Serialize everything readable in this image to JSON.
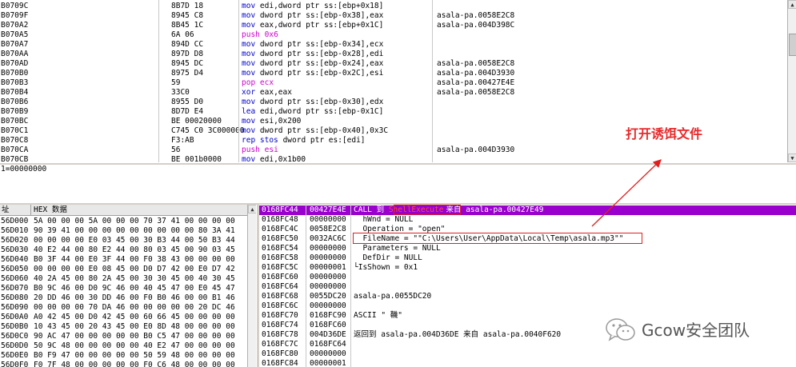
{
  "disasm": {
    "rows": [
      {
        "addr": "B0709C",
        "bytes": "8B7D 18",
        "mnemonic": "mov",
        "args": "edi,dword ptr ss:[ebp+0x18]",
        "comment": ""
      },
      {
        "addr": "B0709F",
        "bytes": "8945 C8",
        "mnemonic": "mov",
        "args": "dword ptr ss:[ebp-0x38],eax",
        "comment": "asala-pa.0058E2C8"
      },
      {
        "addr": "B070A2",
        "bytes": "8B45 1C",
        "mnemonic": "mov",
        "args": "eax,dword ptr ss:[ebp+0x1C]",
        "comment": "asala-pa.004D398C"
      },
      {
        "addr": "B070A5",
        "bytes": "6A 06",
        "mnemonic": "push",
        "args": "0x6",
        "comment": ""
      },
      {
        "addr": "B070A7",
        "bytes": "894D CC",
        "mnemonic": "mov",
        "args": "dword ptr ss:[ebp-0x34],ecx",
        "comment": ""
      },
      {
        "addr": "B070AA",
        "bytes": "897D D8",
        "mnemonic": "mov",
        "args": "dword ptr ss:[ebp-0x28],edi",
        "comment": ""
      },
      {
        "addr": "B070AD",
        "bytes": "8945 DC",
        "mnemonic": "mov",
        "args": "dword ptr ss:[ebp-0x24],eax",
        "comment": "asala-pa.0058E2C8"
      },
      {
        "addr": "B070B0",
        "bytes": "8975 D4",
        "mnemonic": "mov",
        "args": "dword ptr ss:[ebp-0x2C],esi",
        "comment": "asala-pa.004D3930"
      },
      {
        "addr": "B070B3",
        "bytes": "59",
        "mnemonic": "pop",
        "args": "ecx",
        "comment": "asala-pa.00427E4E"
      },
      {
        "addr": "B070B4",
        "bytes": "33C0",
        "mnemonic": "xor",
        "args": "eax,eax",
        "comment": "asala-pa.0058E2C8"
      },
      {
        "addr": "B070B6",
        "bytes": "8955 D0",
        "mnemonic": "mov",
        "args": "dword ptr ss:[ebp-0x30],edx",
        "comment": ""
      },
      {
        "addr": "B070B9",
        "bytes": "8D7D E4",
        "mnemonic": "lea",
        "args": "edi,dword ptr ss:[ebp-0x1C]",
        "comment": ""
      },
      {
        "addr": "B070BC",
        "bytes": "BE 00020000",
        "mnemonic": "mov",
        "args": "esi,0x200",
        "comment": ""
      },
      {
        "addr": "B070C1",
        "bytes": "C745 C0 3C000000",
        "mnemonic": "mov",
        "args": "dword ptr ss:[ebp-0x40],0x3C",
        "comment": ""
      },
      {
        "addr": "B070C8",
        "bytes": "F3:AB",
        "mnemonic": "rep stos",
        "args": "dword ptr es:[edi]",
        "comment": ""
      },
      {
        "addr": "B070CA",
        "bytes": "56",
        "mnemonic": "push",
        "args": "esi",
        "comment": "asala-pa.004D3930"
      },
      {
        "addr": "B070CB",
        "bytes": "BE 001b0000",
        "mnemonic": "mov",
        "args": "edi,0x1b00",
        "comment": ""
      }
    ]
  },
  "status": {
    "text": "1=00000000"
  },
  "hexdump": {
    "header_addr": "址",
    "header_hex": "HEX 数据",
    "rows": [
      {
        "addr": "56D000",
        "hex": "5A 00 00 00 5A 00 00 00 70 37 41 00 00 00 00"
      },
      {
        "addr": "56D010",
        "hex": "90 39 41 00 00 00 00 00 00 00 00 00 80 3A 41"
      },
      {
        "addr": "56D020",
        "hex": "00 00 00 00 E0 03 45 00 30 B3 44 00 50 B3 44"
      },
      {
        "addr": "56D030",
        "hex": "40 E2 44 00 80 E2 44 00 80 03 45 00 90 03 45"
      },
      {
        "addr": "56D040",
        "hex": "B0 3F 44 00 E0 3F 44 00 F0 38 43 00 00 00 00"
      },
      {
        "addr": "56D050",
        "hex": "00 00 00 00 E0 08 45 00 D0 D7 42 00 E0 D7 42"
      },
      {
        "addr": "56D060",
        "hex": "40 2A 45 00 80 2A 45 00 30 30 45 00 40 30 45"
      },
      {
        "addr": "56D070",
        "hex": "B0 9C 46 00 D0 9C 46 00 40 45 47 00 E0 45 47"
      },
      {
        "addr": "56D080",
        "hex": "20 DD 46 00 30 DD 46 00 F0 B0 46 00 00 B1 46"
      },
      {
        "addr": "56D090",
        "hex": "00 00 00 00 70 DA 46 00 00 00 00 00 20 DC 46"
      },
      {
        "addr": "56D0A0",
        "hex": "A0 42 45 00 D0 42 45 00 60 66 45 00 00 00 00"
      },
      {
        "addr": "56D0B0",
        "hex": "10 43 45 00 20 43 45 00 E0 8D 48 00 00 00 00"
      },
      {
        "addr": "56D0C0",
        "hex": "90 AC 47 00 00 00 00 00 B0 C5 47 00 00 00 00"
      },
      {
        "addr": "56D0D0",
        "hex": "50 9C 48 00 00 00 00 00 40 E2 47 00 00 00 00"
      },
      {
        "addr": "56D0E0",
        "hex": "B0 F9 47 00 00 00 00 00 50 59 48 00 00 00 00"
      },
      {
        "addr": "56D0F0",
        "hex": "F0 7F 48 00 00 00 00 00 F0 C6 48 00 00 00 00"
      }
    ]
  },
  "stack": {
    "rows": [
      {
        "addr": "0168FC44",
        "value": "00427E4E",
        "comment_parts": [
          "CALL 到 ",
          "ShellExecute",
          "来自 asala-pa.00427E49"
        ],
        "selected": true
      },
      {
        "addr": "0168FC48",
        "value": "00000000",
        "comment": "  hWnd = NULL"
      },
      {
        "addr": "0168FC4C",
        "value": "0058E2C8",
        "comment": "  Operation = \"open\""
      },
      {
        "addr": "0168FC50",
        "value": "0032AC6C",
        "comment": "  FileName = \"\"C:\\Users\\User\\AppData\\Local\\Temp\\asala.mp3\"\""
      },
      {
        "addr": "0168FC54",
        "value": "00000000",
        "comment": "  Parameters = NULL"
      },
      {
        "addr": "0168FC58",
        "value": "00000000",
        "comment": "  DefDir = NULL"
      },
      {
        "addr": "0168FC5C",
        "value": "00000001",
        "comment": "└IsShown = 0x1"
      },
      {
        "addr": "0168FC60",
        "value": "00000000",
        "comment": ""
      },
      {
        "addr": "0168FC64",
        "value": "00000000",
        "comment": ""
      },
      {
        "addr": "0168FC68",
        "value": "0055DC20",
        "comment": "asala-pa.0055DC20"
      },
      {
        "addr": "0168FC6C",
        "value": "00000000",
        "comment": ""
      },
      {
        "addr": "0168FC70",
        "value": "0168FC90",
        "comment": "ASCII \" 鞿\""
      },
      {
        "addr": "0168FC74",
        "value": "0168FC60",
        "comment": ""
      },
      {
        "addr": "0168FC78",
        "value": "004D36DE",
        "comment": "返回到 asala-pa.004D36DE 来自 asala-pa.0040F620"
      },
      {
        "addr": "0168FC7C",
        "value": "0168FC64",
        "comment": ""
      },
      {
        "addr": "0168FC80",
        "value": "00000000",
        "comment": ""
      },
      {
        "addr": "0168FC84",
        "value": "00000001",
        "comment": ""
      }
    ]
  },
  "annotation": {
    "text": "打开诱饵文件",
    "color": "#e8292b"
  },
  "watermark": {
    "text": "Gcow安全团队",
    "icon": "wechat-icon"
  }
}
